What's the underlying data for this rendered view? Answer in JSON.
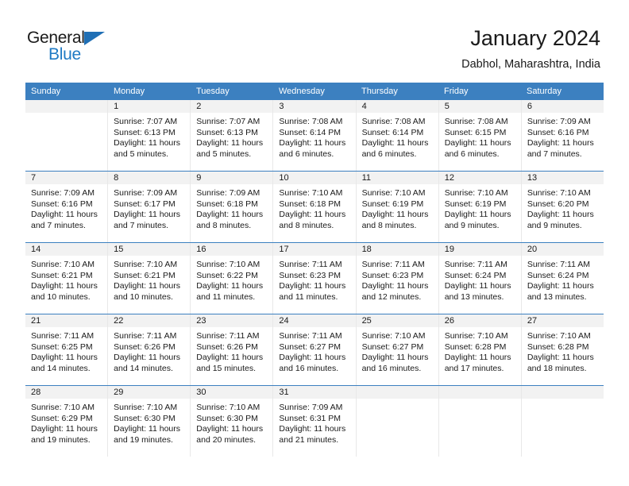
{
  "logo": {
    "word_top": "General",
    "word_bottom": "Blue",
    "triangle_color": "#1f6fb5",
    "blue_color": "#1f7ac4"
  },
  "header": {
    "title": "January 2024",
    "subtitle": "Dabhol, Maharashtra, India"
  },
  "colors": {
    "header_band": "#3c80c0",
    "daynum_band": "#f2f2f2",
    "week_rule": "#3c80c0",
    "text": "#1a1a1a"
  },
  "weekdays": [
    "Sunday",
    "Monday",
    "Tuesday",
    "Wednesday",
    "Thursday",
    "Friday",
    "Saturday"
  ],
  "weeks": [
    [
      {
        "day": "",
        "sunrise": "",
        "sunset": "",
        "daylight_1": "",
        "daylight_2": ""
      },
      {
        "day": "1",
        "sunrise": "Sunrise: 7:07 AM",
        "sunset": "Sunset: 6:13 PM",
        "daylight_1": "Daylight: 11 hours",
        "daylight_2": "and 5 minutes."
      },
      {
        "day": "2",
        "sunrise": "Sunrise: 7:07 AM",
        "sunset": "Sunset: 6:13 PM",
        "daylight_1": "Daylight: 11 hours",
        "daylight_2": "and 5 minutes."
      },
      {
        "day": "3",
        "sunrise": "Sunrise: 7:08 AM",
        "sunset": "Sunset: 6:14 PM",
        "daylight_1": "Daylight: 11 hours",
        "daylight_2": "and 6 minutes."
      },
      {
        "day": "4",
        "sunrise": "Sunrise: 7:08 AM",
        "sunset": "Sunset: 6:14 PM",
        "daylight_1": "Daylight: 11 hours",
        "daylight_2": "and 6 minutes."
      },
      {
        "day": "5",
        "sunrise": "Sunrise: 7:08 AM",
        "sunset": "Sunset: 6:15 PM",
        "daylight_1": "Daylight: 11 hours",
        "daylight_2": "and 6 minutes."
      },
      {
        "day": "6",
        "sunrise": "Sunrise: 7:09 AM",
        "sunset": "Sunset: 6:16 PM",
        "daylight_1": "Daylight: 11 hours",
        "daylight_2": "and 7 minutes."
      }
    ],
    [
      {
        "day": "7",
        "sunrise": "Sunrise: 7:09 AM",
        "sunset": "Sunset: 6:16 PM",
        "daylight_1": "Daylight: 11 hours",
        "daylight_2": "and 7 minutes."
      },
      {
        "day": "8",
        "sunrise": "Sunrise: 7:09 AM",
        "sunset": "Sunset: 6:17 PM",
        "daylight_1": "Daylight: 11 hours",
        "daylight_2": "and 7 minutes."
      },
      {
        "day": "9",
        "sunrise": "Sunrise: 7:09 AM",
        "sunset": "Sunset: 6:18 PM",
        "daylight_1": "Daylight: 11 hours",
        "daylight_2": "and 8 minutes."
      },
      {
        "day": "10",
        "sunrise": "Sunrise: 7:10 AM",
        "sunset": "Sunset: 6:18 PM",
        "daylight_1": "Daylight: 11 hours",
        "daylight_2": "and 8 minutes."
      },
      {
        "day": "11",
        "sunrise": "Sunrise: 7:10 AM",
        "sunset": "Sunset: 6:19 PM",
        "daylight_1": "Daylight: 11 hours",
        "daylight_2": "and 8 minutes."
      },
      {
        "day": "12",
        "sunrise": "Sunrise: 7:10 AM",
        "sunset": "Sunset: 6:19 PM",
        "daylight_1": "Daylight: 11 hours",
        "daylight_2": "and 9 minutes."
      },
      {
        "day": "13",
        "sunrise": "Sunrise: 7:10 AM",
        "sunset": "Sunset: 6:20 PM",
        "daylight_1": "Daylight: 11 hours",
        "daylight_2": "and 9 minutes."
      }
    ],
    [
      {
        "day": "14",
        "sunrise": "Sunrise: 7:10 AM",
        "sunset": "Sunset: 6:21 PM",
        "daylight_1": "Daylight: 11 hours",
        "daylight_2": "and 10 minutes."
      },
      {
        "day": "15",
        "sunrise": "Sunrise: 7:10 AM",
        "sunset": "Sunset: 6:21 PM",
        "daylight_1": "Daylight: 11 hours",
        "daylight_2": "and 10 minutes."
      },
      {
        "day": "16",
        "sunrise": "Sunrise: 7:10 AM",
        "sunset": "Sunset: 6:22 PM",
        "daylight_1": "Daylight: 11 hours",
        "daylight_2": "and 11 minutes."
      },
      {
        "day": "17",
        "sunrise": "Sunrise: 7:11 AM",
        "sunset": "Sunset: 6:23 PM",
        "daylight_1": "Daylight: 11 hours",
        "daylight_2": "and 11 minutes."
      },
      {
        "day": "18",
        "sunrise": "Sunrise: 7:11 AM",
        "sunset": "Sunset: 6:23 PM",
        "daylight_1": "Daylight: 11 hours",
        "daylight_2": "and 12 minutes."
      },
      {
        "day": "19",
        "sunrise": "Sunrise: 7:11 AM",
        "sunset": "Sunset: 6:24 PM",
        "daylight_1": "Daylight: 11 hours",
        "daylight_2": "and 13 minutes."
      },
      {
        "day": "20",
        "sunrise": "Sunrise: 7:11 AM",
        "sunset": "Sunset: 6:24 PM",
        "daylight_1": "Daylight: 11 hours",
        "daylight_2": "and 13 minutes."
      }
    ],
    [
      {
        "day": "21",
        "sunrise": "Sunrise: 7:11 AM",
        "sunset": "Sunset: 6:25 PM",
        "daylight_1": "Daylight: 11 hours",
        "daylight_2": "and 14 minutes."
      },
      {
        "day": "22",
        "sunrise": "Sunrise: 7:11 AM",
        "sunset": "Sunset: 6:26 PM",
        "daylight_1": "Daylight: 11 hours",
        "daylight_2": "and 14 minutes."
      },
      {
        "day": "23",
        "sunrise": "Sunrise: 7:11 AM",
        "sunset": "Sunset: 6:26 PM",
        "daylight_1": "Daylight: 11 hours",
        "daylight_2": "and 15 minutes."
      },
      {
        "day": "24",
        "sunrise": "Sunrise: 7:11 AM",
        "sunset": "Sunset: 6:27 PM",
        "daylight_1": "Daylight: 11 hours",
        "daylight_2": "and 16 minutes."
      },
      {
        "day": "25",
        "sunrise": "Sunrise: 7:10 AM",
        "sunset": "Sunset: 6:27 PM",
        "daylight_1": "Daylight: 11 hours",
        "daylight_2": "and 16 minutes."
      },
      {
        "day": "26",
        "sunrise": "Sunrise: 7:10 AM",
        "sunset": "Sunset: 6:28 PM",
        "daylight_1": "Daylight: 11 hours",
        "daylight_2": "and 17 minutes."
      },
      {
        "day": "27",
        "sunrise": "Sunrise: 7:10 AM",
        "sunset": "Sunset: 6:28 PM",
        "daylight_1": "Daylight: 11 hours",
        "daylight_2": "and 18 minutes."
      }
    ],
    [
      {
        "day": "28",
        "sunrise": "Sunrise: 7:10 AM",
        "sunset": "Sunset: 6:29 PM",
        "daylight_1": "Daylight: 11 hours",
        "daylight_2": "and 19 minutes."
      },
      {
        "day": "29",
        "sunrise": "Sunrise: 7:10 AM",
        "sunset": "Sunset: 6:30 PM",
        "daylight_1": "Daylight: 11 hours",
        "daylight_2": "and 19 minutes."
      },
      {
        "day": "30",
        "sunrise": "Sunrise: 7:10 AM",
        "sunset": "Sunset: 6:30 PM",
        "daylight_1": "Daylight: 11 hours",
        "daylight_2": "and 20 minutes."
      },
      {
        "day": "31",
        "sunrise": "Sunrise: 7:09 AM",
        "sunset": "Sunset: 6:31 PM",
        "daylight_1": "Daylight: 11 hours",
        "daylight_2": "and 21 minutes."
      },
      {
        "day": "",
        "sunrise": "",
        "sunset": "",
        "daylight_1": "",
        "daylight_2": ""
      },
      {
        "day": "",
        "sunrise": "",
        "sunset": "",
        "daylight_1": "",
        "daylight_2": ""
      },
      {
        "day": "",
        "sunrise": "",
        "sunset": "",
        "daylight_1": "",
        "daylight_2": ""
      }
    ]
  ]
}
